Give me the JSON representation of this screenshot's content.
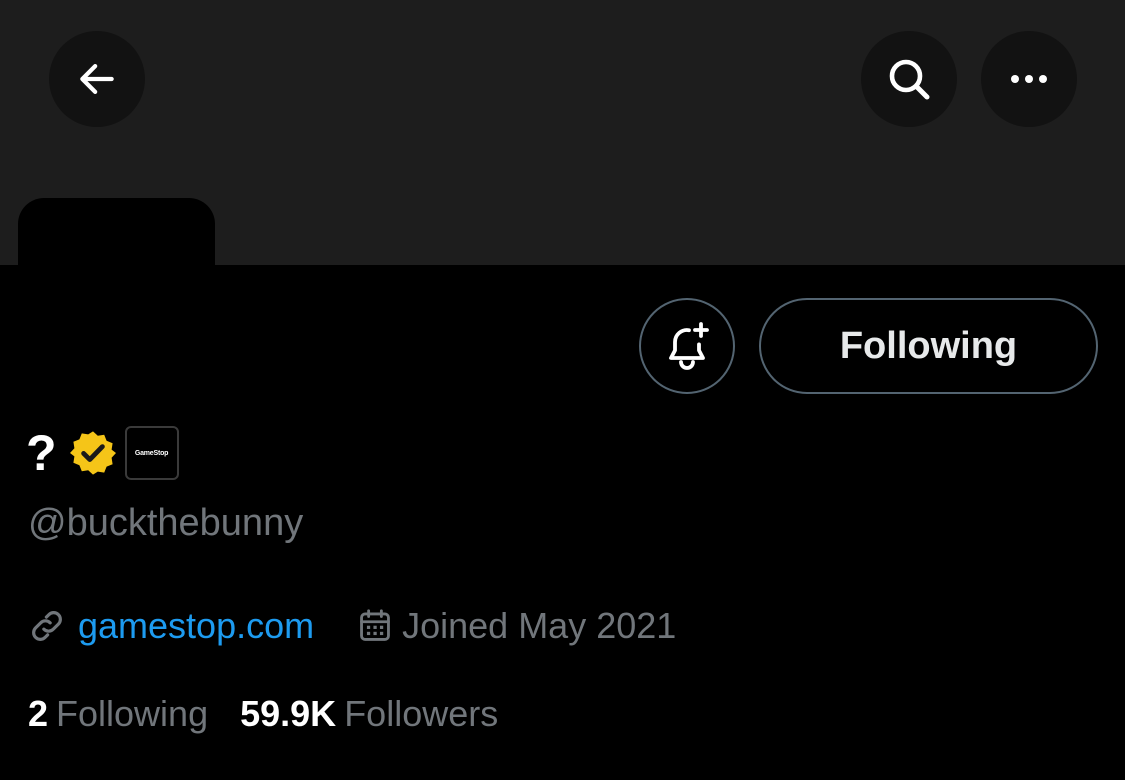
{
  "header": {
    "back_icon": "arrow-left-icon",
    "search_icon": "search-icon",
    "more_icon": "more-horizontal-icon"
  },
  "actions": {
    "notify_icon": "bell-plus-icon",
    "follow_label": "Following"
  },
  "profile": {
    "display_name": "?",
    "verified_badge_color": "#f5c518",
    "affiliate_label": "GameStop",
    "handle": "@buckthebunny",
    "website": "gamestop.com",
    "joined": "Joined May 2021"
  },
  "stats": {
    "following_count": "2",
    "following_label": "Following",
    "followers_count": "59.9K",
    "followers_label": "Followers"
  },
  "colors": {
    "background": "#000000",
    "banner": "#1d1d1d",
    "link": "#1d9bf0",
    "secondary_text": "#71767b",
    "button_border": "#536471"
  }
}
